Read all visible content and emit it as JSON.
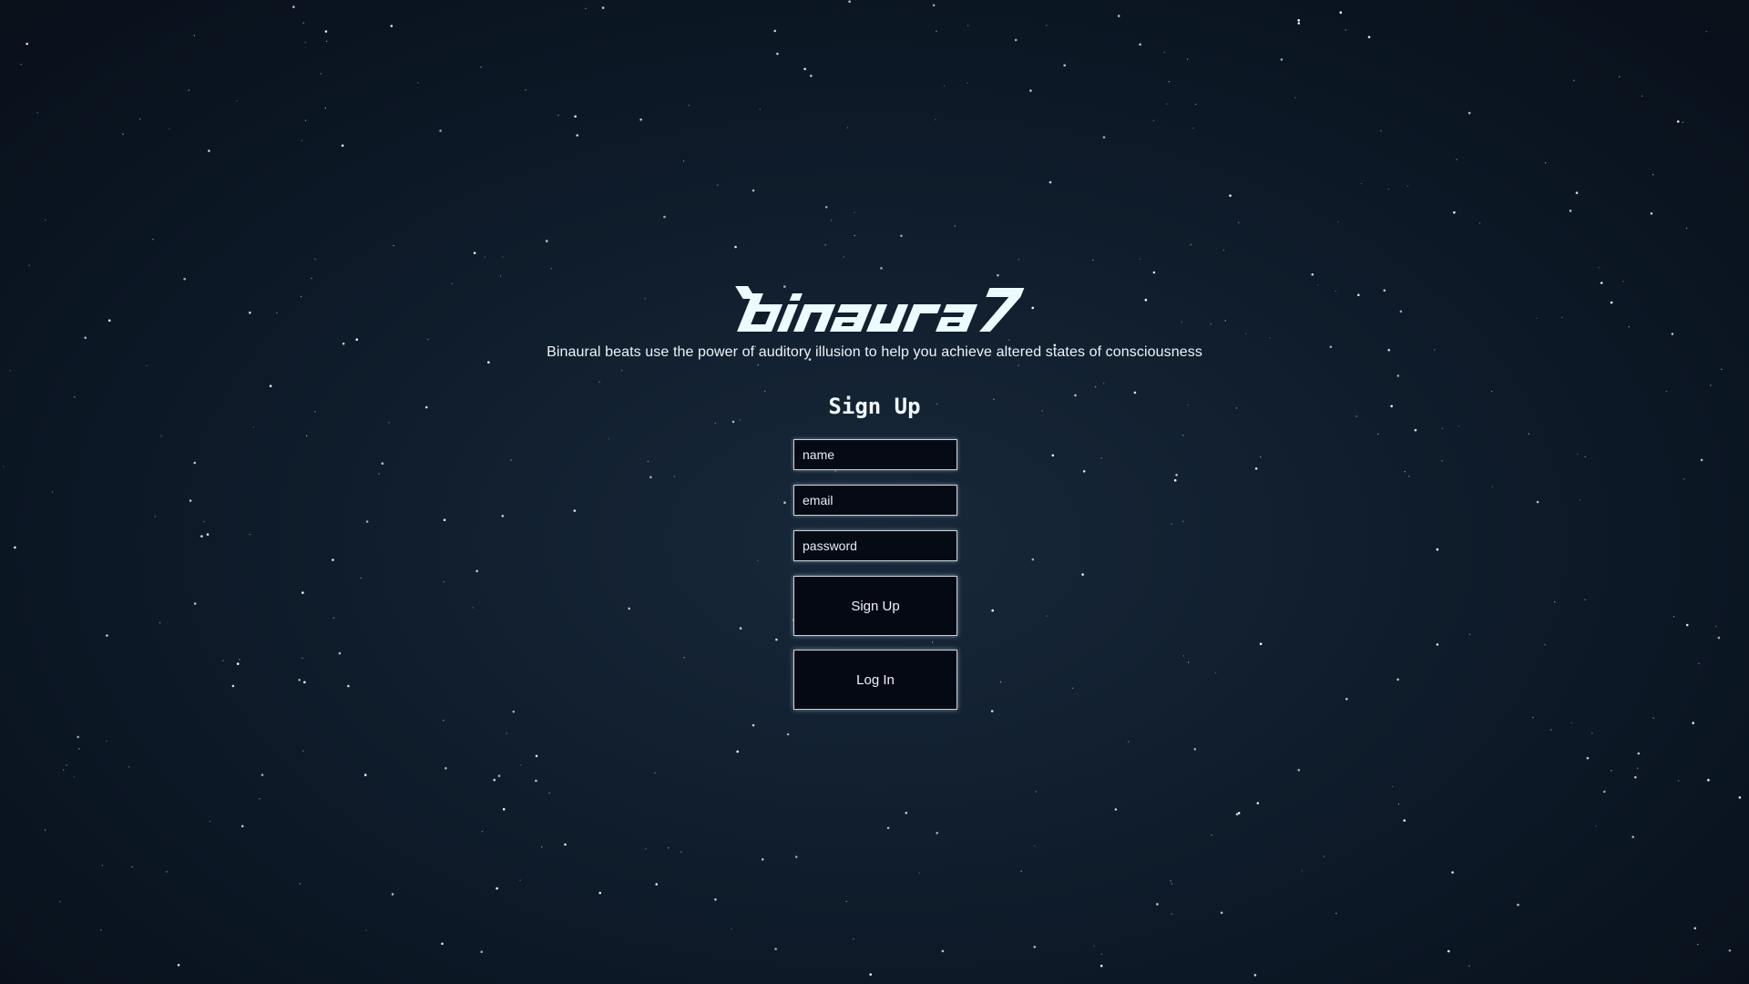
{
  "app": {
    "logo_text": "binaural",
    "tagline": "Binaural beats use the power of auditory illusion to help you achieve altered states of consciousness"
  },
  "signup_form": {
    "title": "Sign Up",
    "name_placeholder": "name",
    "email_placeholder": "email",
    "password_placeholder": "password",
    "signup_button_label": "Sign Up",
    "login_button_label": "Log In"
  },
  "theme": {
    "background": "#0f1c2b",
    "logo_color": "#ecfbff",
    "field_background": "#050a14",
    "field_border": "#c8d3dc"
  }
}
